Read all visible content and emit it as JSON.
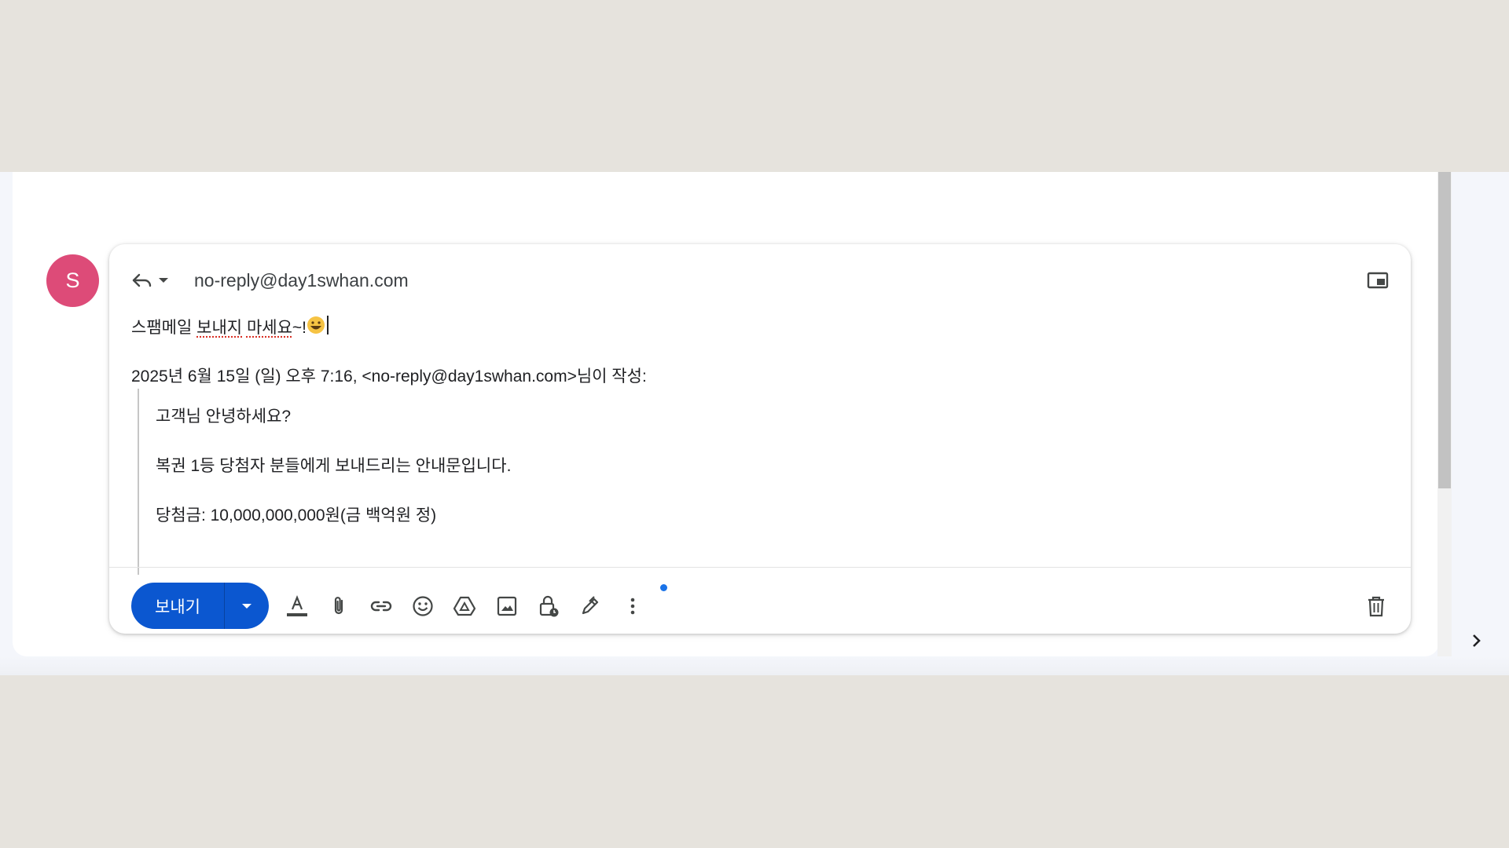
{
  "avatar": {
    "initial": "S",
    "color": "#dd4b78"
  },
  "compose": {
    "recipient": "no-reply@day1swhan.com",
    "body": {
      "reply_text_part1": "스팸메일 ",
      "reply_text_part2": "보내지",
      "reply_text_part3": " ",
      "reply_text_part4": "마세요",
      "reply_text_part5": "~!",
      "quote_header": "2025년 6월 15일 (일) 오후 7:16, <no-reply@day1swhan.com>님이 작성:",
      "quoted_lines": [
        "고객님 안녕하세요?",
        "복권 1등 당첨자 분들에게 보내드리는 안내문입니다.",
        "당첨금: 10,000,000,000원(금 백억원 정)"
      ]
    }
  },
  "toolbar": {
    "send_label": "보내기",
    "accent": "#0b57d0",
    "icons": [
      "text-format-icon",
      "attach-icon",
      "link-icon",
      "emoji-icon",
      "drive-icon",
      "image-icon",
      "confidential-icon",
      "signature-icon",
      "more-options-icon"
    ]
  }
}
